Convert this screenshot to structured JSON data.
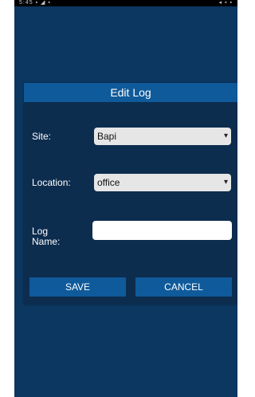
{
  "status_bar": {
    "left": "5:45 ▪ ◢ ▪",
    "right": "◂ ▪ ▪"
  },
  "dialog": {
    "title": "Edit Log",
    "fields": {
      "site": {
        "label": "Site:",
        "value": "Bapi"
      },
      "location": {
        "label": "Location:",
        "value": "office"
      },
      "log_name": {
        "label": "Log\nName:",
        "value": "",
        "placeholder": ""
      }
    },
    "buttons": {
      "save": "SAVE",
      "cancel": "CANCEL"
    }
  },
  "colors": {
    "background": "#0b3760",
    "dialog_background": "#0d2d4f",
    "accent": "#0f5a9a"
  },
  "icons": {
    "dropdown": "triangle-down"
  }
}
